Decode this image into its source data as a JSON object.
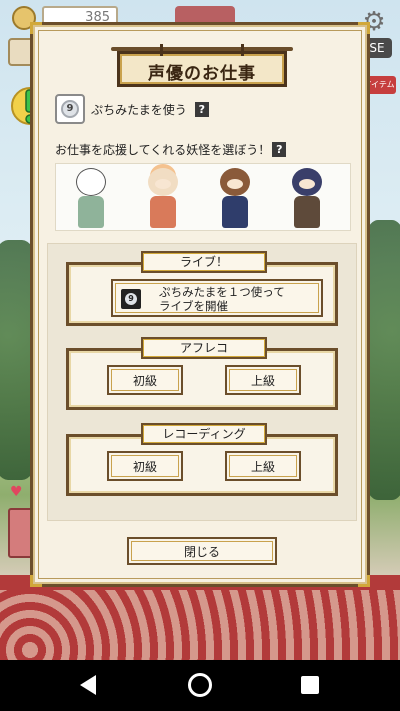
{
  "hud": {
    "coin_label": "金",
    "coin_value": "385",
    "se_label": "SE",
    "item_label": "アイテム"
  },
  "dialog": {
    "title": "声優のお仕事",
    "ticket_label": "ぷちみたまを使う",
    "ticket_number": "9",
    "help_symbol": "?",
    "choose_label": "お仕事を応援してくれる妖怪を選ぼう！",
    "characters": [
      "yokai-1",
      "yokai-2",
      "yokai-3",
      "yokai-4"
    ],
    "jobs": {
      "live": {
        "tag": "ライブ！",
        "ticket_number": "9",
        "line1": "ぷちみたまを１つ使って",
        "line2": "ライブを開催"
      },
      "afreco": {
        "tag": "アフレコ",
        "beginner": "初級",
        "advanced": "上級"
      },
      "recording": {
        "tag": "レコーディング",
        "beginner": "初級",
        "advanced": "上級"
      }
    },
    "close_label": "閉じる"
  },
  "icons": {
    "alert": "exclamation-icon",
    "gear": "gear-icon",
    "back": "back-triangle-icon",
    "home": "home-circle-icon",
    "recent": "recent-square-icon"
  },
  "colors": {
    "frame": "#6b4e2b",
    "gold_trim": "#d1a83a",
    "paper": "#f7f1e3",
    "floor_red": "#b23a3a"
  }
}
